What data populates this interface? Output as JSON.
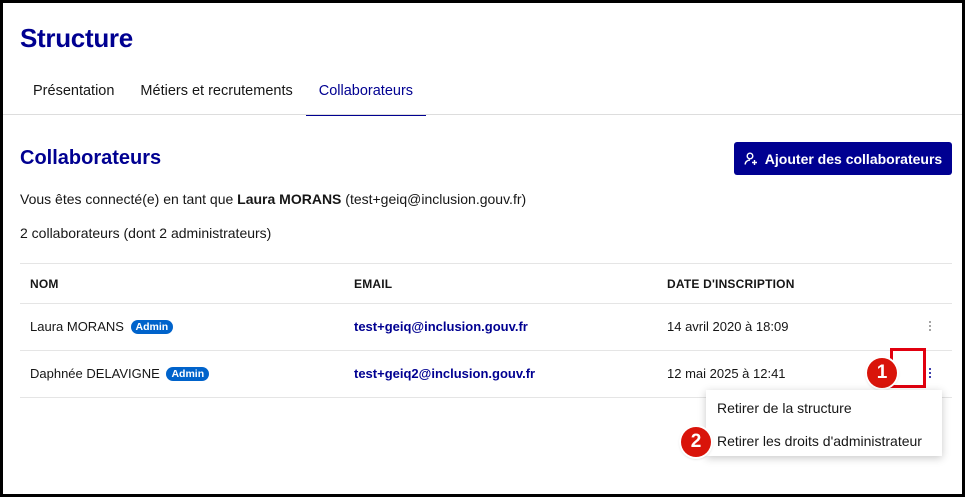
{
  "page": {
    "title": "Structure"
  },
  "tabs": [
    {
      "label": "Présentation"
    },
    {
      "label": "Métiers et recrutements"
    },
    {
      "label": "Collaborateurs",
      "active": true
    }
  ],
  "section": {
    "title": "Collaborateurs",
    "add_button": "Ajouter des collaborateurs",
    "connected_prefix": "Vous êtes connecté(e) en tant que",
    "connected_name": "Laura MORANS",
    "connected_email": "(test+geiq@inclusion.gouv.fr)",
    "count": "2 collaborateurs (dont 2 administrateurs)"
  },
  "table": {
    "headers": {
      "name": "NOM",
      "email": "EMAIL",
      "date": "DATE D'INSCRIPTION"
    },
    "rows": [
      {
        "name": "Laura MORANS",
        "badge": "Admin",
        "email": "test+geiq@inclusion.gouv.fr",
        "date": "14 avril 2020 à 18:09"
      },
      {
        "name": "Daphnée DELAVIGNE",
        "badge": "Admin",
        "email": "test+geiq2@inclusion.gouv.fr",
        "date": "12 mai 2025 à 12:41"
      }
    ]
  },
  "menu": {
    "items": [
      {
        "label": "Retirer de la structure"
      },
      {
        "label": "Retirer les droits d'administrateur"
      }
    ]
  },
  "annotations": {
    "step1": "1",
    "step2": "2"
  },
  "colors": {
    "primary": "#000091",
    "badge": "#0063cb",
    "annotation": "#e1000f"
  },
  "icons": {
    "add_button_icon": "user-add-icon",
    "row_menu_icon": "kebab-menu-icon"
  }
}
